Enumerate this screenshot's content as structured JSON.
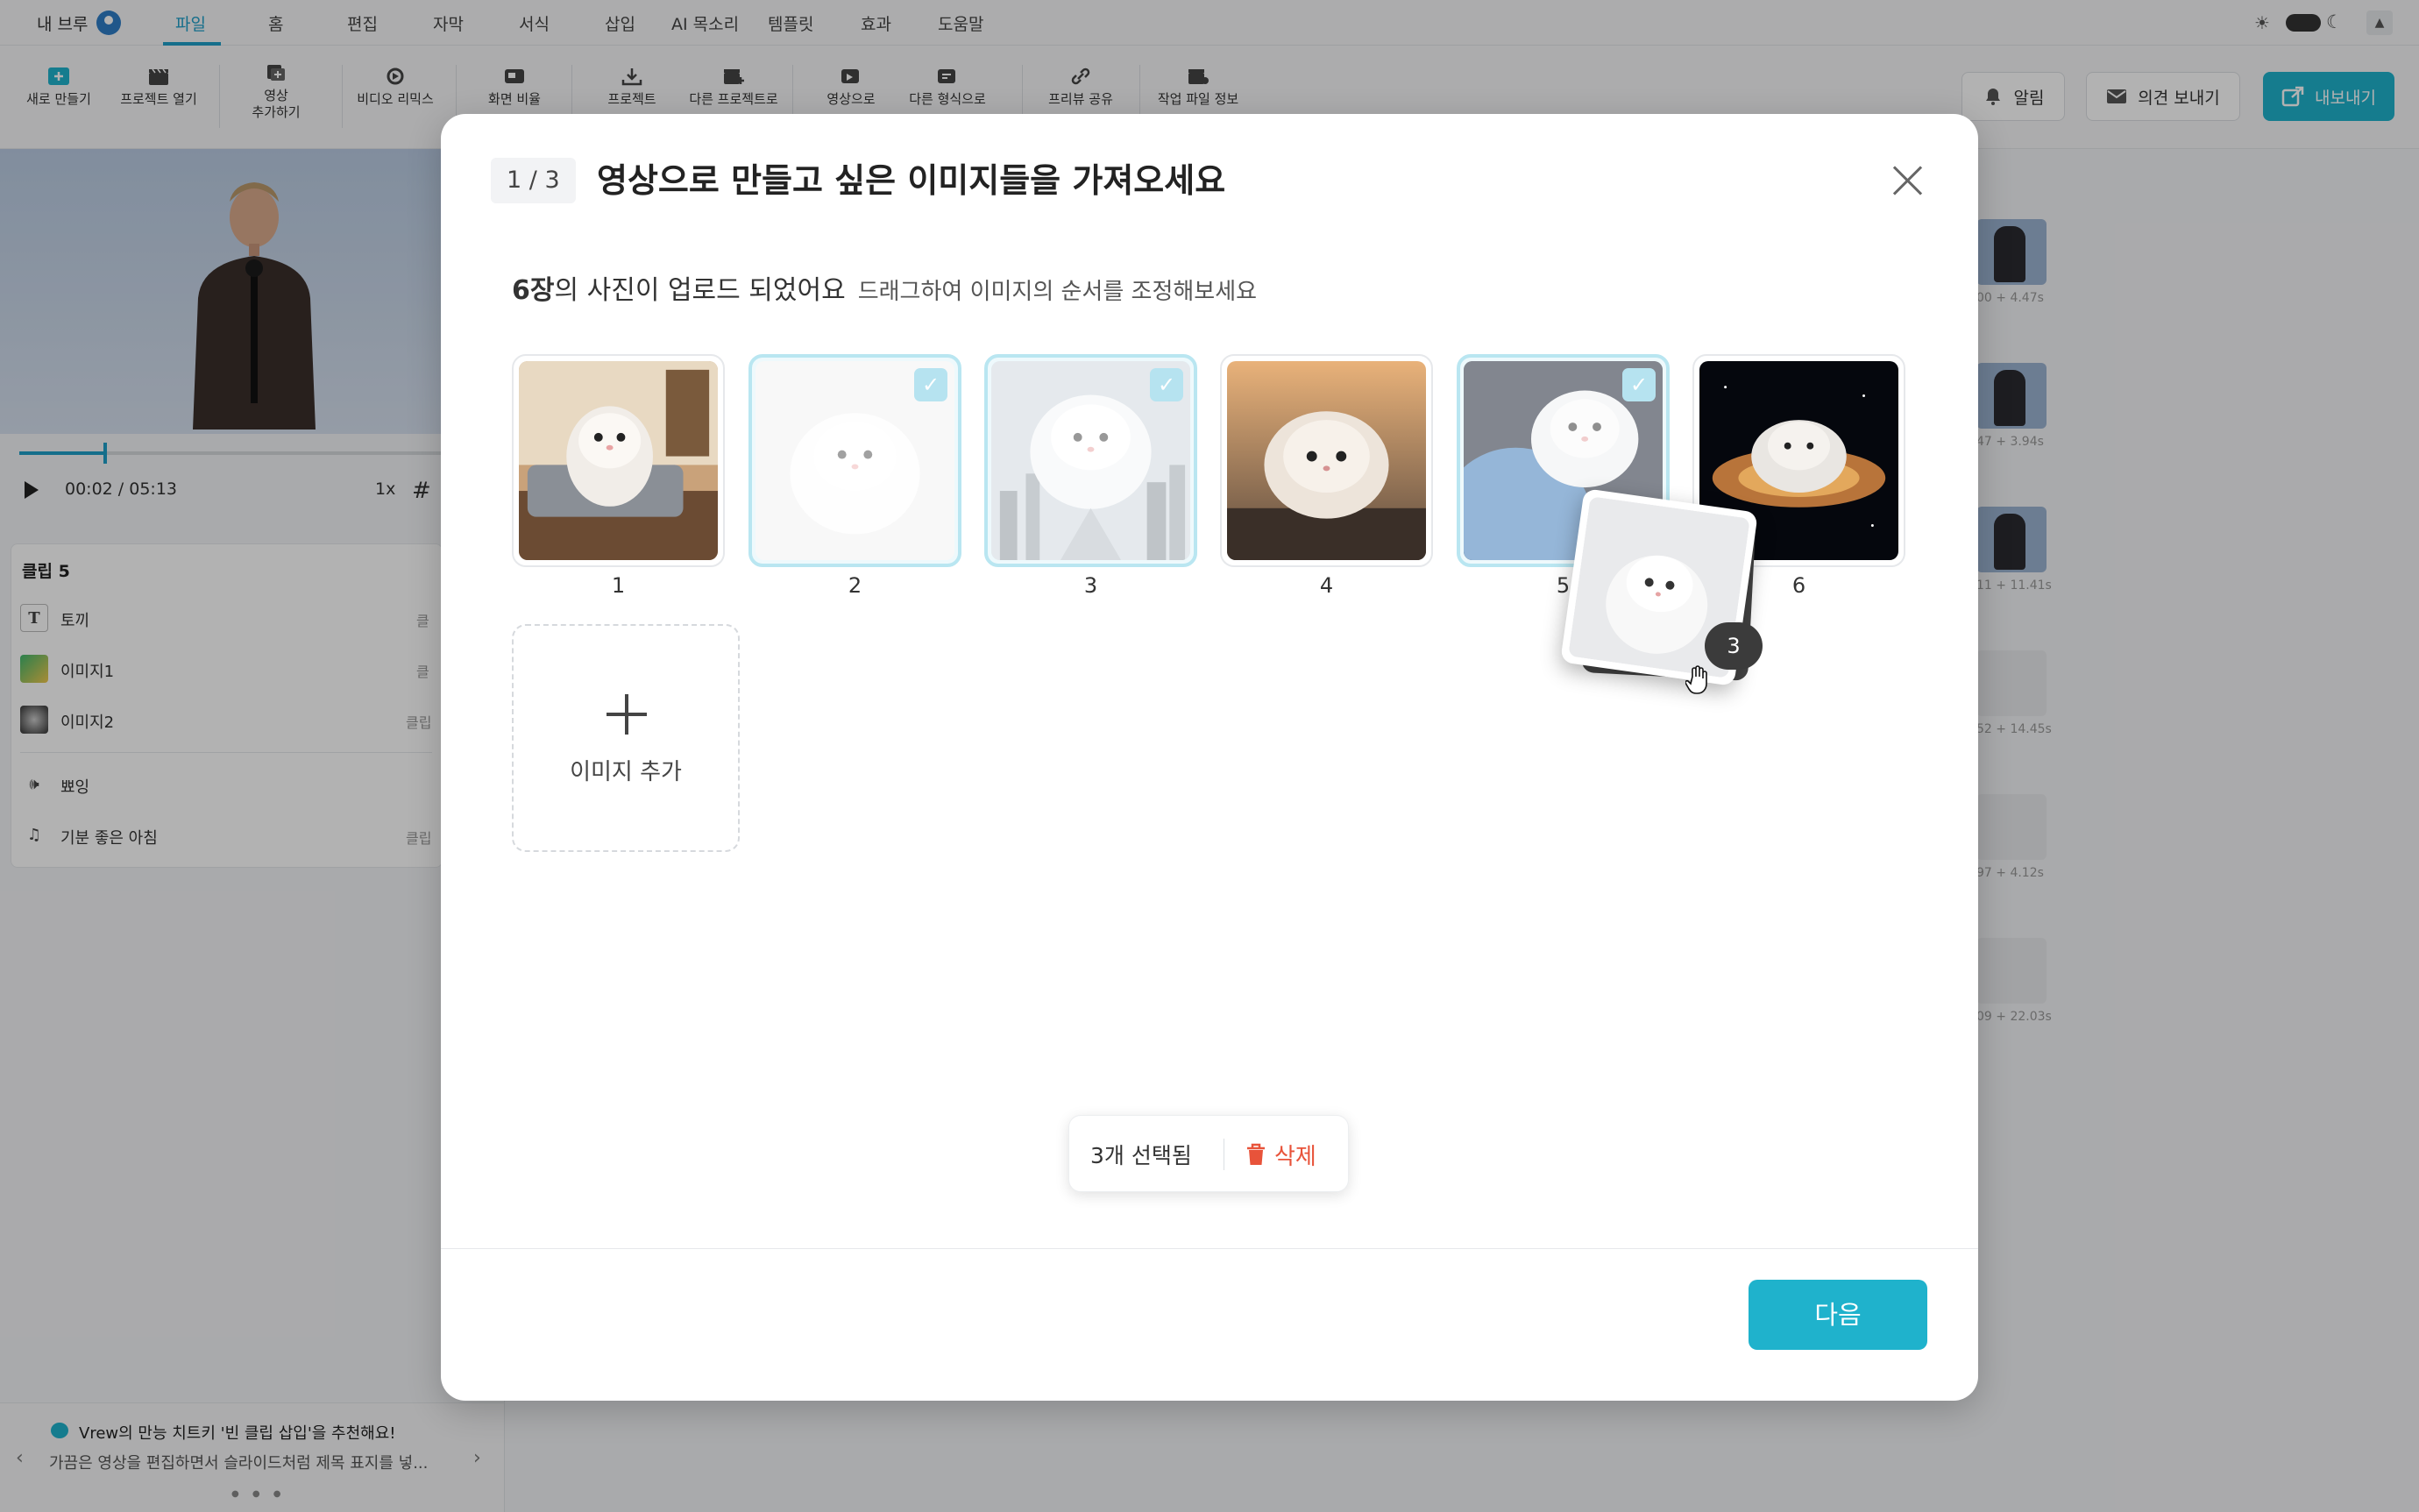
{
  "menu": {
    "brand": "내 브루",
    "items": [
      "파일",
      "홈",
      "편집",
      "자막",
      "서식",
      "삽입",
      "AI 목소리",
      "템플릿",
      "효과",
      "도움말"
    ],
    "active": "파일"
  },
  "toolbar": {
    "tools": [
      {
        "label": "새로 만들기",
        "icon": "new-icon"
      },
      {
        "label": "프로젝트 열기",
        "icon": "clapper-icon"
      },
      {
        "label": "영상\n추가하기",
        "icon": "add-video-icon"
      },
      {
        "label": "비디오 리믹스",
        "icon": "remix-icon"
      },
      {
        "label": "화면 비율",
        "icon": "ratio-icon"
      },
      {
        "label": "프로젝트",
        "icon": "download-icon"
      },
      {
        "label": "다른 프로젝트로",
        "icon": "clapper-plus-icon"
      },
      {
        "label": "영상으로",
        "icon": "image-video-icon"
      },
      {
        "label": "다른 형식으로",
        "icon": "export-format-icon"
      },
      {
        "label": "프리뷰 공유",
        "icon": "link-icon"
      },
      {
        "label": "작업 파일 정보",
        "icon": "file-info-icon"
      }
    ],
    "notify": "알림",
    "feedback": "의견 보내기",
    "export": "내보내기"
  },
  "player": {
    "time": "00:02 / 05:13",
    "speed": "1x",
    "progress_fraction": 0.2
  },
  "clips": {
    "title": "클립 5",
    "rows": [
      {
        "label": "토끼",
        "icon": "text-icon",
        "tag": "클"
      },
      {
        "label": "이미지1",
        "icon": "image-icon",
        "tag": "클"
      },
      {
        "label": "이미지2",
        "icon": "image-icon",
        "tag": "클립"
      },
      {
        "label": "뾰잉",
        "icon": "sound-icon",
        "tag": ""
      },
      {
        "label": "기분 좋은 아침",
        "icon": "music-icon",
        "tag": "클립"
      }
    ]
  },
  "tip": {
    "title": "Vrew의 만능 치트키 '빈 클립 삽입'을 추천해요!",
    "body": "가끔은 영상을 편집하면서  슬라이드처럼 제목 표지를 넣..."
  },
  "right_clips": [
    "00 + 4.47s",
    "47 + 3.94s",
    "11 + 11.41s",
    "52 + 14.45s",
    "97 + 4.12s",
    "09 + 22.03s"
  ],
  "modal": {
    "step": "1 / 3",
    "title": "영상으로 만들고 싶은 이미지들을 가져오세요",
    "count_strong": "6장",
    "count_rest": "의 사진이 업로드 되었어요",
    "hint": "드래그하여 이미지의 순서를 조정해보세요",
    "images": [
      {
        "num": "1",
        "selected": false
      },
      {
        "num": "2",
        "selected": true
      },
      {
        "num": "3",
        "selected": true
      },
      {
        "num": "4",
        "selected": false
      },
      {
        "num": "5",
        "selected": true
      },
      {
        "num": "6",
        "selected": false
      }
    ],
    "add_label": "이미지 추가",
    "drag_count": "3",
    "selected_text": "3개 선택됨",
    "delete_label": "삭제",
    "next_label": "다음"
  },
  "colors": {
    "accent": "#1fb2cc",
    "danger": "#e8533a",
    "selected_border": "#b9e6f1"
  }
}
